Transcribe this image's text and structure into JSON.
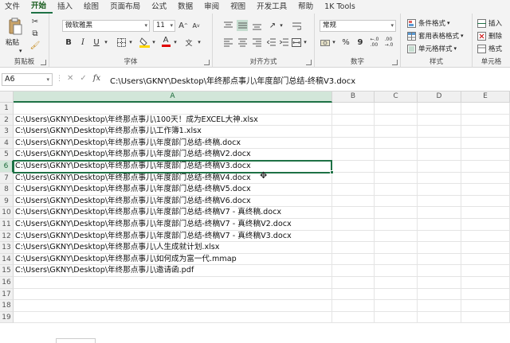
{
  "menu": {
    "tabs": [
      "文件",
      "开始",
      "插入",
      "绘图",
      "页面布局",
      "公式",
      "数据",
      "审阅",
      "视图",
      "开发工具",
      "帮助",
      "1K Tools"
    ],
    "active": "开始"
  },
  "ribbon": {
    "clipboard": {
      "label": "剪贴板",
      "paste": "粘贴"
    },
    "font": {
      "label": "字体",
      "name": "微软雅黑",
      "size": "11",
      "bold": "B",
      "italic": "I",
      "underline": "U",
      "grow": "A",
      "shrink": "A",
      "wen": "文"
    },
    "alignment": {
      "label": "对齐方式"
    },
    "number": {
      "label": "数字",
      "format": "常规",
      "percent": "%",
      "comma": "9"
    },
    "styles": {
      "label": "样式",
      "conditional": "条件格式",
      "table": "套用表格格式",
      "cell": "单元格样式"
    },
    "cells": {
      "label": "单元格",
      "insert": "插入",
      "delete": "删除",
      "format": "格式"
    }
  },
  "formula_bar": {
    "name_box": "A6",
    "fx": "fx",
    "content": "C:\\Users\\GKNY\\Desktop\\年终那点事儿\\年度部门总结-终稿V3.docx"
  },
  "grid": {
    "columns": [
      "A",
      "B",
      "C",
      "D",
      "E"
    ],
    "selected_column": "A",
    "selected_row": "6",
    "rows": [
      "1",
      "2",
      "3",
      "4",
      "5",
      "6",
      "7",
      "8",
      "9",
      "10",
      "11",
      "12",
      "13",
      "14",
      "15",
      "16",
      "17",
      "18",
      "19"
    ],
    "cells_a": [
      "",
      "C:\\Users\\GKNY\\Desktop\\年终那点事儿\\100天！成为EXCEL大神.xlsx",
      "C:\\Users\\GKNY\\Desktop\\年终那点事儿\\工作簿1.xlsx",
      "C:\\Users\\GKNY\\Desktop\\年终那点事儿\\年度部门总结-终稿.docx",
      "C:\\Users\\GKNY\\Desktop\\年终那点事儿\\年度部门总结-终稿V2.docx",
      "C:\\Users\\GKNY\\Desktop\\年终那点事儿\\年度部门总结-终稿V3.docx",
      "C:\\Users\\GKNY\\Desktop\\年终那点事儿\\年度部门总结-终稿V4.docx",
      "C:\\Users\\GKNY\\Desktop\\年终那点事儿\\年度部门总结-终稿V5.docx",
      "C:\\Users\\GKNY\\Desktop\\年终那点事儿\\年度部门总结-终稿V6.docx",
      "C:\\Users\\GKNY\\Desktop\\年终那点事儿\\年度部门总结-终稿V7 - 真终稿.docx",
      "C:\\Users\\GKNY\\Desktop\\年终那点事儿\\年度部门总结-终稿V7 - 真终稿V2.docx",
      "C:\\Users\\GKNY\\Desktop\\年终那点事儿\\年度部门总结-终稿V7 - 真终稿V3.docx",
      "C:\\Users\\GKNY\\Desktop\\年终那点事儿\\人生成就计划.xlsx",
      "C:\\Users\\GKNY\\Desktop\\年终那点事儿\\如何成为富一代.mmap",
      "C:\\Users\\GKNY\\Desktop\\年终那点事儿\\邀请函.pdf",
      "",
      "",
      "",
      ""
    ]
  },
  "colors": {
    "accent": "#1e7145",
    "ribbon_bg": "#f3f3f3"
  }
}
